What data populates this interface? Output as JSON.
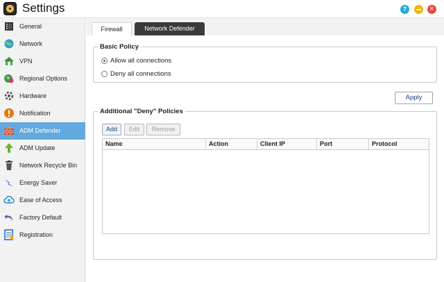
{
  "window": {
    "title": "Settings"
  },
  "sidebar": {
    "items": [
      {
        "label": "General",
        "icon": "general-icon"
      },
      {
        "label": "Network",
        "icon": "globe-icon"
      },
      {
        "label": "VPN",
        "icon": "vpn-icon"
      },
      {
        "label": "Regional Options",
        "icon": "regional-icon"
      },
      {
        "label": "Hardware",
        "icon": "hardware-icon"
      },
      {
        "label": "Notification",
        "icon": "notification-icon"
      },
      {
        "label": "ADM Defender",
        "icon": "firewall-icon",
        "active": true
      },
      {
        "label": "ADM Update",
        "icon": "update-arrow-icon"
      },
      {
        "label": "Network Recycle Bin",
        "icon": "recycle-bin-icon"
      },
      {
        "label": "Energy Saver",
        "icon": "energy-icon"
      },
      {
        "label": "Ease of Access",
        "icon": "cloud-icon"
      },
      {
        "label": "Factory Default",
        "icon": "undo-icon"
      },
      {
        "label": "Registration",
        "icon": "registration-icon"
      }
    ]
  },
  "tabs": [
    {
      "label": "Firewall",
      "active": true
    },
    {
      "label": "Network Defender",
      "active": false
    }
  ],
  "basic_policy": {
    "title": "Basic Policy",
    "options": [
      {
        "label": "Allow all connections",
        "checked": true
      },
      {
        "label": "Deny all connections",
        "checked": false
      }
    ]
  },
  "apply_label": "Apply",
  "deny_policies": {
    "title": "Additional \"Deny\" Policies",
    "add_label": "Add",
    "edit_label": "Edit",
    "remove_label": "Remove",
    "columns": [
      "Name",
      "Action",
      "Client IP",
      "Port",
      "Protocol"
    ],
    "rows": []
  },
  "colors": {
    "accent": "#64a9de",
    "help": "#25a9d8",
    "minimize": "#f4b400",
    "close": "#e54b3c"
  }
}
